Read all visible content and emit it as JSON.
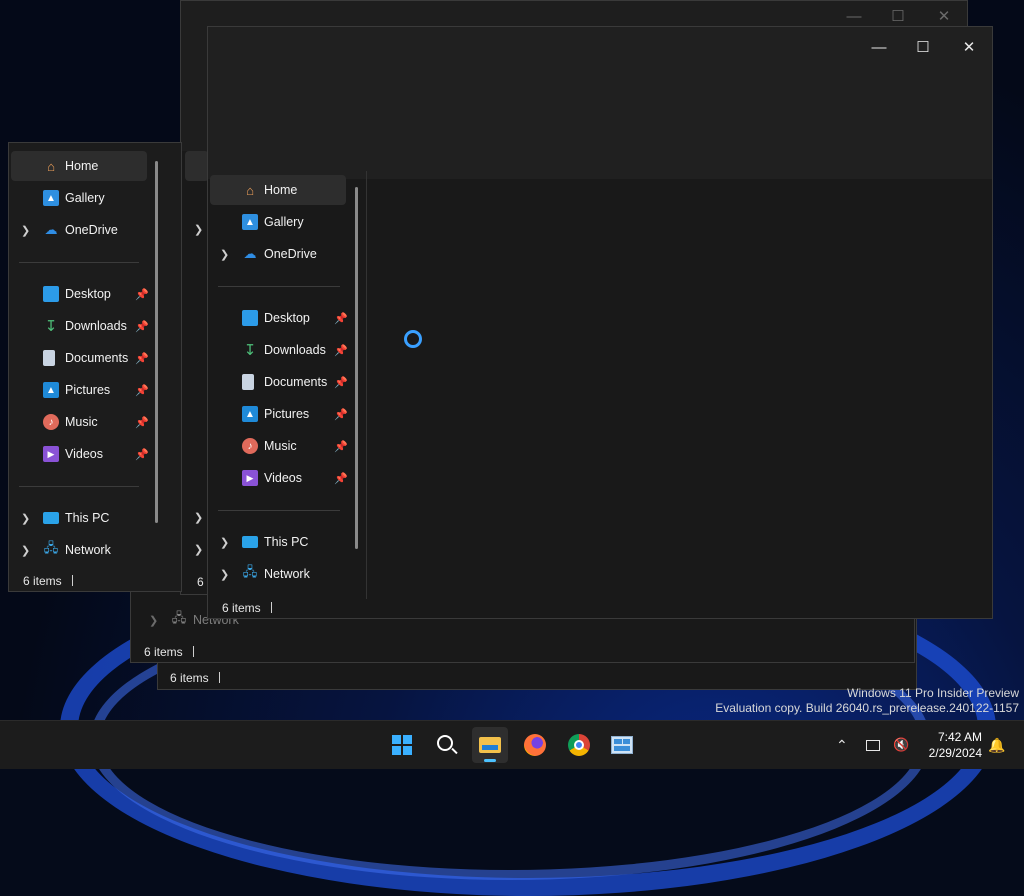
{
  "nav_items": {
    "home": "Home",
    "gallery": "Gallery",
    "onedrive": "OneDrive",
    "desktop": "Desktop",
    "downloads": "Downloads",
    "documents": "Documents",
    "pictures": "Pictures",
    "music": "Music",
    "videos": "Videos",
    "this_pc": "This PC",
    "network": "Network"
  },
  "status": {
    "items_count": "6 items"
  },
  "watermark": {
    "line1": "Windows 11 Pro Insider Preview",
    "line2": "Evaluation copy. Build 26040.rs_prerelease.240122-1157"
  },
  "clock": {
    "time": "7:42 AM",
    "date": "2/29/2024"
  },
  "taskbar_apps": [
    "start-icon",
    "search-icon",
    "file-explorer-icon",
    "firefox-icon",
    "chrome-icon",
    "control-panel-icon"
  ],
  "tray_icons": [
    "chevron-up-icon",
    "network-icon",
    "volume-muted-icon",
    "notification-bell-icon"
  ],
  "colors": {
    "accent": "#4cc2ff",
    "spinner": "#3aa0ff",
    "window_bg": "#1c1c1c",
    "titlebar_bg": "#202020",
    "taskbar_bg": "#1c1c1c"
  }
}
